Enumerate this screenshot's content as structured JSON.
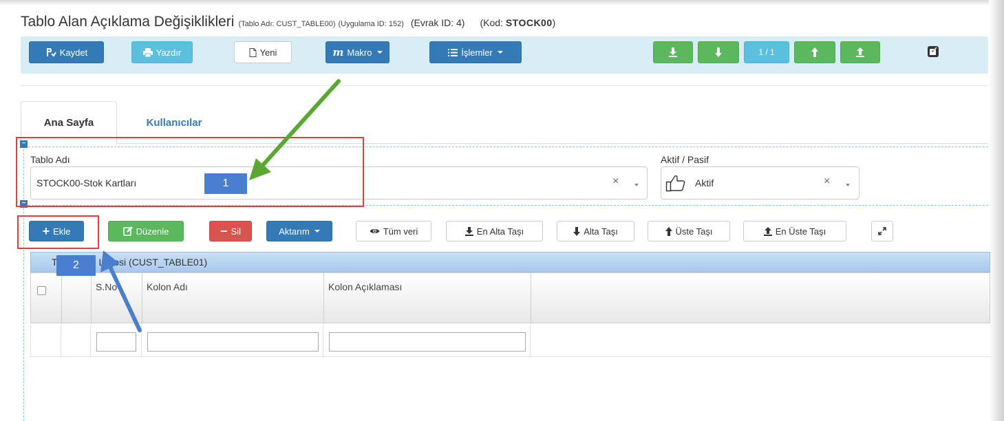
{
  "title": {
    "main": "Tablo Alan Açıklama Değişiklikleri",
    "table_name": "(Tablo Adı: CUST_TABLE00)",
    "app_id": "(Uygulama ID: 152)",
    "doc_id": "(Evrak ID: 4)",
    "code_prefix": "(Kod:",
    "code_value": "STOCK00",
    "code_suffix": ")"
  },
  "toolbar": {
    "save": "Kaydet",
    "print": "Yazdır",
    "new": "Yeni",
    "macro": "Makro",
    "operations": "İşlemler",
    "pager": "1 / 1"
  },
  "tabs": [
    {
      "label": "Ana Sayfa",
      "active": true
    },
    {
      "label": "Kullanıcılar",
      "active": false
    }
  ],
  "form": {
    "table_name_label": "Tablo Adı",
    "table_name_value": "STOCK00-Stok Kartları",
    "status_label": "Aktif / Pasif",
    "status_value": "Aktif",
    "clear_glyph": "×"
  },
  "callouts": {
    "one": "1",
    "two": "2"
  },
  "grid_toolbar": {
    "add": "Ekle",
    "edit": "Düzenle",
    "delete": "Sil",
    "transfer": "Aktarım",
    "all_data": "Tüm veri",
    "move_bottom": "En Alta Taşı",
    "move_down": "Alta Taşı",
    "move_up": "Üste Taşı",
    "move_top": "En Üste Taşı"
  },
  "grid": {
    "caption_start": "Ta",
    "caption_end": "o Listesi (CUST_TABLE01)",
    "col_sno": "S.No",
    "col_name": "Kolon Adı",
    "col_desc": "Kolon Açıklaması"
  },
  "colors": {
    "primary": "#337ab7",
    "info": "#5bc0de",
    "success": "#5cb85c",
    "danger": "#d9534f",
    "callout": "#e0403a",
    "arrow_green": "#5aa832",
    "arrow_blue": "#4a7fcf"
  }
}
